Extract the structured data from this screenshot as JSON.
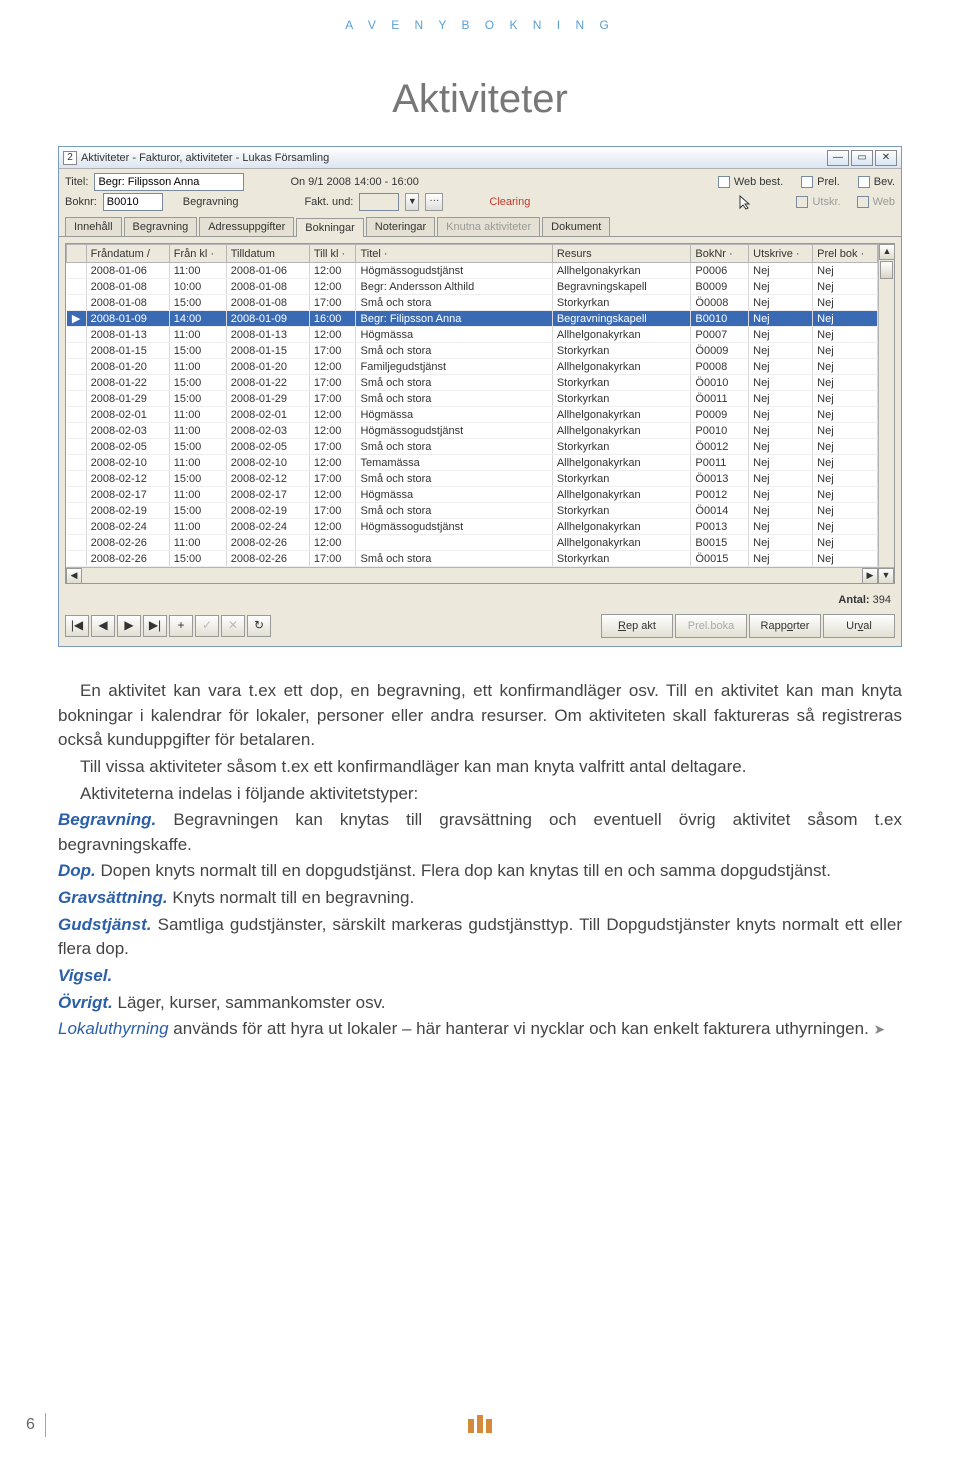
{
  "header": "A V E N Y   B O K N I N G",
  "title": "Aktiviteter",
  "window": {
    "icon": "2",
    "title": "Aktiviteter - Fakturor, aktiviteter - Lukas Församling",
    "form": {
      "titel_label": "Titel:",
      "titel_value": "Begr: Filipsson Anna",
      "on_label": "On 9/1 2008 14:00 - 16:00",
      "boknr_label": "Boknr:",
      "boknr_value": "B0010",
      "boknr_text": "Begravning",
      "faktund_label": "Fakt. und:",
      "clearing": "Clearing",
      "webbest": "Web best.",
      "prel": "Prel.",
      "bev": "Bev.",
      "utskr": "Utskr.",
      "web": "Web"
    },
    "tabs": [
      "Innehåll",
      "Begravning",
      "Adressuppgifter",
      "Bokningar",
      "Noteringar",
      "Knutna aktiviteter",
      "Dokument"
    ],
    "tabs_active": 3,
    "tabs_disabled": [
      5
    ],
    "columns": [
      "Fråndatum",
      "Från kl",
      "Tilldatum",
      "Till kl",
      "Titel",
      "Resurs",
      "BokNr",
      "Utskrive",
      "Prel bok"
    ],
    "rows": [
      {
        "d0": "2008-01-06",
        "t0": "11:00",
        "d1": "2008-01-06",
        "t1": "12:00",
        "title": "Högmässogudstjänst",
        "res": "Allhelgonakyrkan",
        "bk": "P0006",
        "u": "Nej",
        "p": "Nej"
      },
      {
        "d0": "2008-01-08",
        "t0": "10:00",
        "d1": "2008-01-08",
        "t1": "12:00",
        "title": "Begr: Andersson Althild",
        "res": "Begravningskapell",
        "bk": "B0009",
        "u": "Nej",
        "p": "Nej"
      },
      {
        "d0": "2008-01-08",
        "t0": "15:00",
        "d1": "2008-01-08",
        "t1": "17:00",
        "title": "Små och stora",
        "res": "Storkyrkan",
        "bk": "Ö0008",
        "u": "Nej",
        "p": "Nej"
      },
      {
        "d0": "2008-01-09",
        "t0": "14:00",
        "d1": "2008-01-09",
        "t1": "16:00",
        "title": "Begr: Filipsson Anna",
        "res": "Begravningskapell",
        "bk": "B0010",
        "u": "Nej",
        "p": "Nej",
        "sel": true
      },
      {
        "d0": "2008-01-13",
        "t0": "11:00",
        "d1": "2008-01-13",
        "t1": "12:00",
        "title": "Högmässa",
        "res": "Allhelgonakyrkan",
        "bk": "P0007",
        "u": "Nej",
        "p": "Nej"
      },
      {
        "d0": "2008-01-15",
        "t0": "15:00",
        "d1": "2008-01-15",
        "t1": "17:00",
        "title": "Små och stora",
        "res": "Storkyrkan",
        "bk": "Ö0009",
        "u": "Nej",
        "p": "Nej"
      },
      {
        "d0": "2008-01-20",
        "t0": "11:00",
        "d1": "2008-01-20",
        "t1": "12:00",
        "title": "Familjegudstjänst",
        "res": "Allhelgonakyrkan",
        "bk": "P0008",
        "u": "Nej",
        "p": "Nej"
      },
      {
        "d0": "2008-01-22",
        "t0": "15:00",
        "d1": "2008-01-22",
        "t1": "17:00",
        "title": "Små och stora",
        "res": "Storkyrkan",
        "bk": "Ö0010",
        "u": "Nej",
        "p": "Nej"
      },
      {
        "d0": "2008-01-29",
        "t0": "15:00",
        "d1": "2008-01-29",
        "t1": "17:00",
        "title": "Små och stora",
        "res": "Storkyrkan",
        "bk": "Ö0011",
        "u": "Nej",
        "p": "Nej"
      },
      {
        "d0": "2008-02-01",
        "t0": "11:00",
        "d1": "2008-02-01",
        "t1": "12:00",
        "title": "Högmässa",
        "res": "Allhelgonakyrkan",
        "bk": "P0009",
        "u": "Nej",
        "p": "Nej"
      },
      {
        "d0": "2008-02-03",
        "t0": "11:00",
        "d1": "2008-02-03",
        "t1": "12:00",
        "title": "Högmässogudstjänst",
        "res": "Allhelgonakyrkan",
        "bk": "P0010",
        "u": "Nej",
        "p": "Nej"
      },
      {
        "d0": "2008-02-05",
        "t0": "15:00",
        "d1": "2008-02-05",
        "t1": "17:00",
        "title": "Små och stora",
        "res": "Storkyrkan",
        "bk": "Ö0012",
        "u": "Nej",
        "p": "Nej"
      },
      {
        "d0": "2008-02-10",
        "t0": "11:00",
        "d1": "2008-02-10",
        "t1": "12:00",
        "title": "Temamässa",
        "res": "Allhelgonakyrkan",
        "bk": "P0011",
        "u": "Nej",
        "p": "Nej"
      },
      {
        "d0": "2008-02-12",
        "t0": "15:00",
        "d1": "2008-02-12",
        "t1": "17:00",
        "title": "Små och stora",
        "res": "Storkyrkan",
        "bk": "Ö0013",
        "u": "Nej",
        "p": "Nej"
      },
      {
        "d0": "2008-02-17",
        "t0": "11:00",
        "d1": "2008-02-17",
        "t1": "12:00",
        "title": "Högmässa",
        "res": "Allhelgonakyrkan",
        "bk": "P0012",
        "u": "Nej",
        "p": "Nej"
      },
      {
        "d0": "2008-02-19",
        "t0": "15:00",
        "d1": "2008-02-19",
        "t1": "17:00",
        "title": "Små och stora",
        "res": "Storkyrkan",
        "bk": "Ö0014",
        "u": "Nej",
        "p": "Nej"
      },
      {
        "d0": "2008-02-24",
        "t0": "11:00",
        "d1": "2008-02-24",
        "t1": "12:00",
        "title": "Högmässogudstjänst",
        "res": "Allhelgonakyrkan",
        "bk": "P0013",
        "u": "Nej",
        "p": "Nej"
      },
      {
        "d0": "2008-02-26",
        "t0": "11:00",
        "d1": "2008-02-26",
        "t1": "12:00",
        "title": "",
        "res": "Allhelgonakyrkan",
        "bk": "B0015",
        "u": "Nej",
        "p": "Nej"
      },
      {
        "d0": "2008-02-26",
        "t0": "15:00",
        "d1": "2008-02-26",
        "t1": "17:00",
        "title": "Små och stora",
        "res": "Storkyrkan",
        "bk": "Ö0015",
        "u": "Nej",
        "p": "Nej"
      }
    ],
    "antal_label": "Antal:",
    "antal_value": "394",
    "nav": {
      "first": "⏮",
      "prev": "◀",
      "next": "▶",
      "last": "⏭",
      "add": "+",
      "check": "✓",
      "del": "✕",
      "refresh": "↻"
    },
    "buttons": {
      "repakt": "Rep akt",
      "prelboka": "Prel.boka",
      "rapporter": "Rapporter",
      "urval": "Urval"
    }
  },
  "article": {
    "p1": "En aktivitet kan vara t.ex ett dop, en begravning, ett konfirmandläger osv. Till en aktivitet kan man knyta bokningar i kalendrar för lokaler, personer eller andra resurser. Om aktiviteten skall faktureras så registreras också kunduppgifter för betalaren.",
    "p2": "Till vissa aktiviteter såsom t.ex ett konfirmandläger kan man knyta valfritt antal deltagare.",
    "p3": "Aktiviteterna indelas i följande aktivitetstyper:",
    "b1": "Begravning.",
    "b1t": " Begravningen kan knytas till gravsättning och eventuell övrig aktivitet såsom t.ex begravningskaffe.",
    "b2": "Dop.",
    "b2t": " Dopen knyts normalt till en dopgudstjänst. Flera dop kan knytas till en och samma dopgudstjänst.",
    "b3": "Gravsättning.",
    "b3t": " Knyts normalt till en begravning.",
    "b4": "Gudstjänst.",
    "b4t": " Samtliga gudstjänster, särskilt markeras gudstjänsttyp. Till Dopgudstjänster knyts normalt ett eller flera dop.",
    "b5": "Vigsel.",
    "b6": "Övrigt.",
    "b6t": " Läger, kurser, sammankomster osv.",
    "b7l": "Lokaluthyrning",
    "b7t": " används för att hyra ut lokaler – här hanterar vi nycklar och kan enkelt fakturera uthyrningen.  "
  },
  "page_number": "6"
}
